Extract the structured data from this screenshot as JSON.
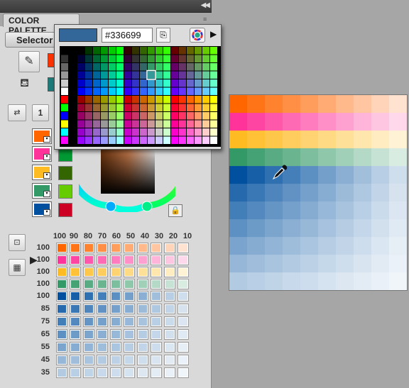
{
  "panel": {
    "title": "COLOR PALETTE",
    "selector_tab": "Selector",
    "swap_label": "1",
    "collapse_icon": "double-chevron-left"
  },
  "popup": {
    "hex_value": "#336699",
    "preview_color": "#336699",
    "icons": [
      "copy-icon",
      "color-wheel-icon",
      "menu-arrow-icon"
    ]
  },
  "tools": {
    "pencil_icon": "pencil-icon",
    "bucket_icon": "paint-bucket-icon",
    "stroke_swatch": "#ff6600",
    "fill_swatch": "#336699"
  },
  "harmony": {
    "wells": [
      "#ff6600",
      "#ff3399",
      "#ffbb22",
      "#339966",
      "#00509f"
    ],
    "chips": [
      "#009933",
      "#336600",
      "#66cc00",
      "#cc0022"
    ]
  },
  "tint_table": {
    "header": [
      "100",
      "90",
      "80",
      "70",
      "60",
      "50",
      "40",
      "30",
      "20",
      "10"
    ],
    "rows": [
      "100",
      "100",
      "100",
      "100",
      "100",
      "85",
      "75",
      "65",
      "55",
      "45",
      "35"
    ],
    "selected_row": 1,
    "arrow_glyph": "▶"
  },
  "colors": {
    "panel_bg": "#d9d9d9",
    "desktop_bg": "#a6a6a6",
    "orange": "#ff6600",
    "pink": "#ff3399",
    "gold": "#ffbb22",
    "green": "#339966",
    "blue": "#00509f"
  }
}
